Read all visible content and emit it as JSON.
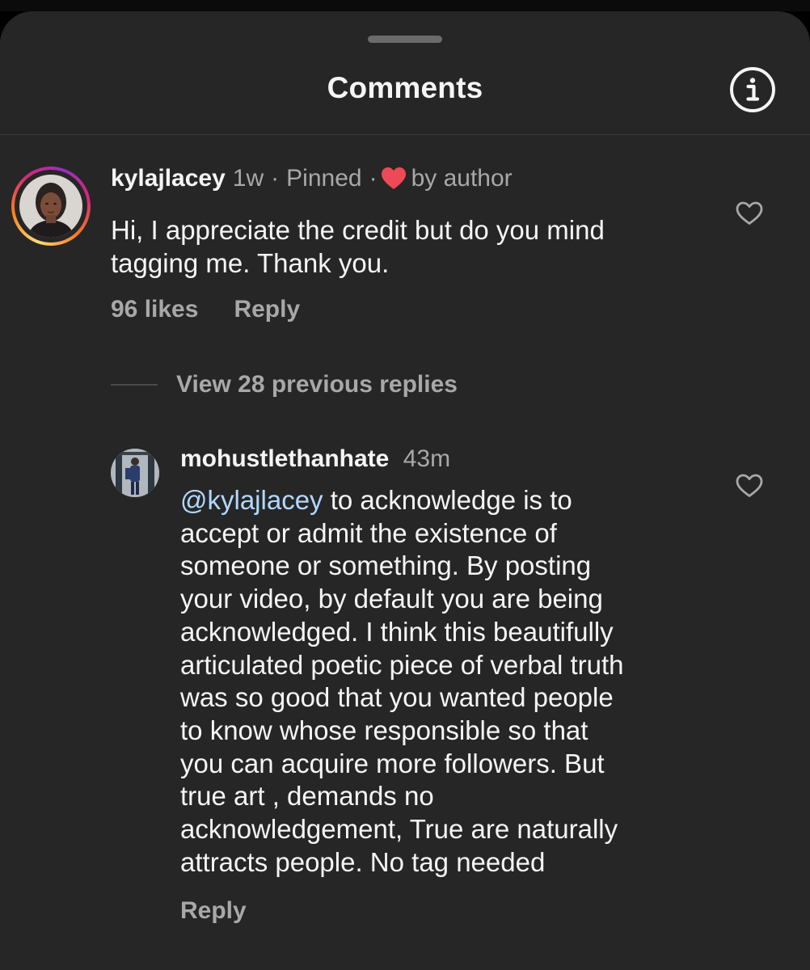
{
  "header": {
    "title": "Comments",
    "info_icon": "info-circle-icon"
  },
  "comments": [
    {
      "username": "kylajlacey",
      "time": "1w",
      "separator1": "·",
      "pinned": "Pinned",
      "separator2": "·",
      "liked_by": "by author",
      "text_lines": [
        "Hi, I appreciate the credit but do you mind",
        "tagging me. Thank you."
      ],
      "likes": "96 likes",
      "reply_label": "Reply",
      "avatar_icon": "profile-photo",
      "heart_color": "#ed4956"
    }
  ],
  "view_replies": "View 28 previous replies",
  "reply": {
    "username": "mohustlethanhate",
    "time": "43m",
    "mention": "@kylajlacey",
    "text_lines": [
      " to acknowledge is to",
      "accept or admit the existence of",
      "someone or something. By posting",
      "your video, by default you are being",
      "acknowledged. I think this beautifully",
      "articulated poetic piece of verbal truth",
      "was so good that you wanted people",
      "to know whose responsible so that",
      "you can acquire more followers. But",
      "true art , demands no",
      "acknowledgement, True are naturally",
      "attracts people. No tag needed"
    ],
    "reply_label": "Reply",
    "avatar_icon": "profile-photo"
  },
  "colors": {
    "sheet_background": "#262626",
    "primary_text": "#f5f5f5",
    "secondary_text": "#a8a8a8",
    "mention": "#b3d8ff",
    "heart": "#ed4956"
  }
}
